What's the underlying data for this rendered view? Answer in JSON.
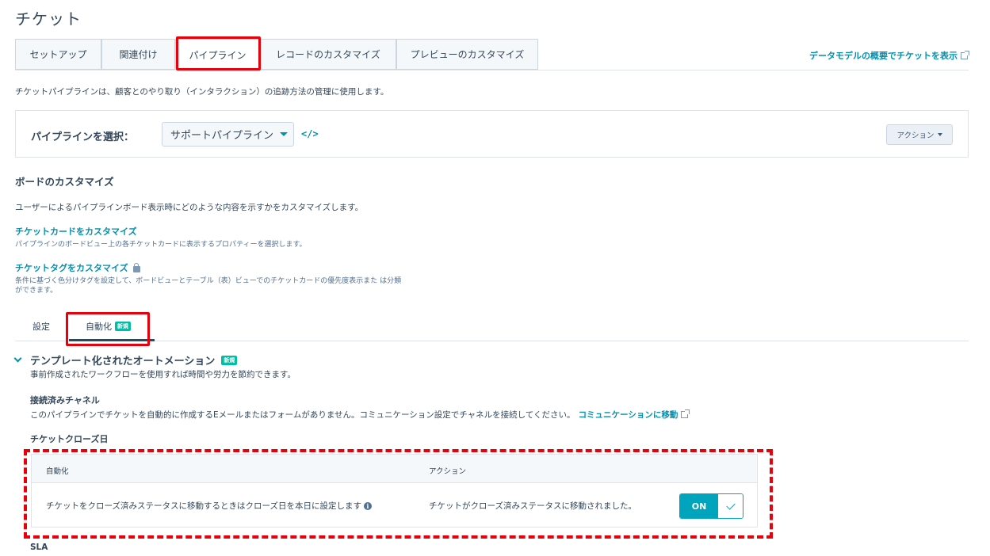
{
  "page": {
    "title": "チケット"
  },
  "tabs": [
    {
      "label": "セットアップ"
    },
    {
      "label": "関連付け"
    },
    {
      "label": "パイプライン"
    },
    {
      "label": "レコードのカスタマイズ"
    },
    {
      "label": "プレビューのカスタマイズ"
    }
  ],
  "active_tab": "パイプライン",
  "data_model_link": "データモデルの概要でチケットを表示",
  "pipeline_description": "チケットパイプラインは、顧客とのやり取り（インタラクション）の追跡方法の管理に使用します。",
  "pipeline_select": {
    "label": "パイプラインを選択：",
    "selected": "サポートパイプライン",
    "code_icon": "</>",
    "actions_label": "アクション"
  },
  "board": {
    "title": "ボードのカスタマイズ",
    "description": "ユーザーによるパイプラインボード表示時にどのような内容を示すかをカスタマイズします。",
    "card_link": "チケットカードをカスタマイズ",
    "card_desc": "パイプラインのボードビュー上の各チケットカードに表示するプロパティーを選択します。",
    "tag_link": "チケットタグをカスタマイズ",
    "tag_desc": "条件に基づく色分けタグを設定して、ボードビューとテーブル（表）ビューでのチケットカードの優先度表示また は分類ができます。"
  },
  "subtabs": {
    "settings": "設定",
    "automation": "自動化",
    "new_badge": "新規"
  },
  "templated": {
    "title": "テンプレート化されたオートメーション",
    "badge": "新規",
    "description": "事前作成されたワークフローを使用すれば時間や労力を節約できます。"
  },
  "channels": {
    "title": "接続済みチャネル",
    "text": "このパイプラインでチケットを自動的に作成するEメールまたはフォームがありません。コミュニケーション設定でチャネルを接続してください。",
    "link": "コミュニケーションに移動"
  },
  "close_date": {
    "title": "チケットクローズ日",
    "col_automation": "自動化",
    "col_action": "アクション",
    "row_automation": "チケットをクローズ済みステータスに移動するときはクローズ日を本日に設定します",
    "row_action": "チケットがクローズ済みステータスに移動されました。",
    "toggle_label": "ON",
    "toggle_on": true
  },
  "sla": {
    "title": "SLA"
  },
  "colors": {
    "accent": "#0091ae",
    "toggle": "#00a4bd",
    "badge": "#00bda5",
    "highlight": "#e8000b",
    "text": "#33475b"
  }
}
